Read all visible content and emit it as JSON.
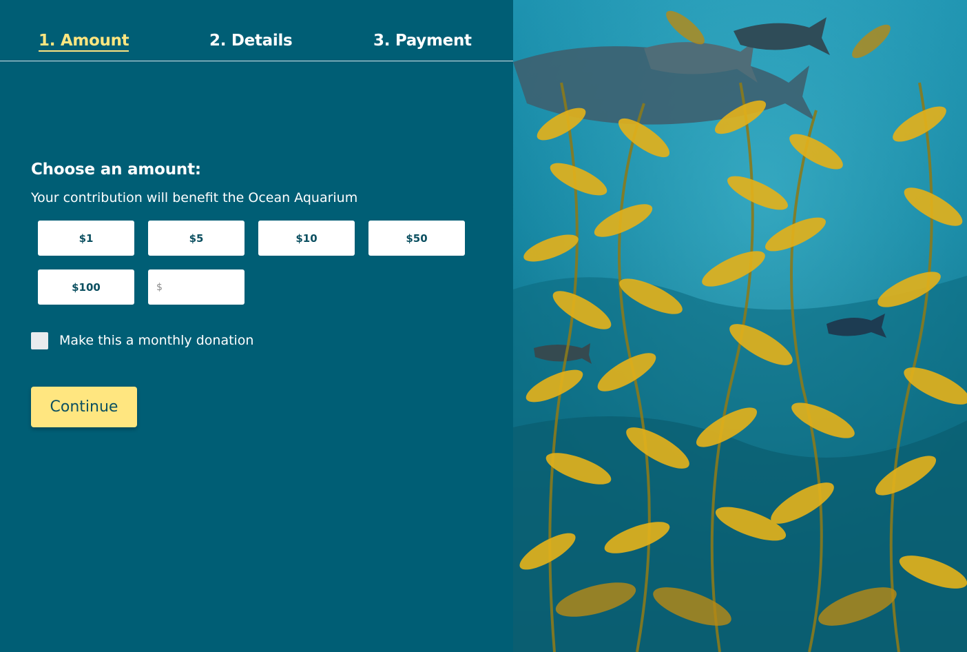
{
  "steps": [
    {
      "label": "1. Amount",
      "active": true
    },
    {
      "label": "2. Details",
      "active": false
    },
    {
      "label": "3. Payment",
      "active": false
    }
  ],
  "form": {
    "heading": "Choose an amount:",
    "subtext": "Your contribution will benefit the Ocean Aquarium",
    "amounts": [
      "$1",
      "$5",
      "$10",
      "$50",
      "$100"
    ],
    "custom_amount": {
      "currency_symbol": "$",
      "value": ""
    },
    "monthly_label": "Make this a monthly donation",
    "monthly_checked": false,
    "continue_label": "Continue"
  },
  "colors": {
    "background": "#005e75",
    "accent": "#ffe680",
    "button_text": "#0b4f60"
  }
}
